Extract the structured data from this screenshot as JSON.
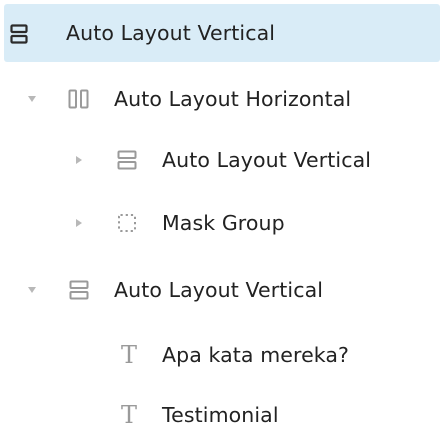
{
  "layers": [
    {
      "label": "Auto Layout Vertical",
      "icon": "auto-layout-vertical-icon",
      "chevron": "none",
      "selected": true
    },
    {
      "label": "Auto Layout Horizontal",
      "icon": "auto-layout-horizontal-icon",
      "chevron": "expanded",
      "selected": false
    },
    {
      "label": "Auto Layout Vertical",
      "icon": "auto-layout-vertical-icon",
      "chevron": "collapsed",
      "selected": false
    },
    {
      "label": "Mask Group",
      "icon": "mask-group-icon",
      "chevron": "collapsed",
      "selected": false
    },
    {
      "label": "Auto Layout Vertical",
      "icon": "auto-layout-vertical-icon",
      "chevron": "expanded",
      "selected": false
    },
    {
      "label": "Apa kata mereka?",
      "icon": "text-layer-icon",
      "glyph": "T",
      "chevron": "none",
      "selected": false
    },
    {
      "label": "Testimonial",
      "icon": "text-layer-icon",
      "glyph": "T",
      "chevron": "none",
      "selected": false
    }
  ],
  "colors": {
    "selection": "#d9ecf7",
    "text": "#222222",
    "icon_dark": "#2b2b2b",
    "icon_light": "#9a9a9a",
    "chevron": "#b8b8b8"
  }
}
